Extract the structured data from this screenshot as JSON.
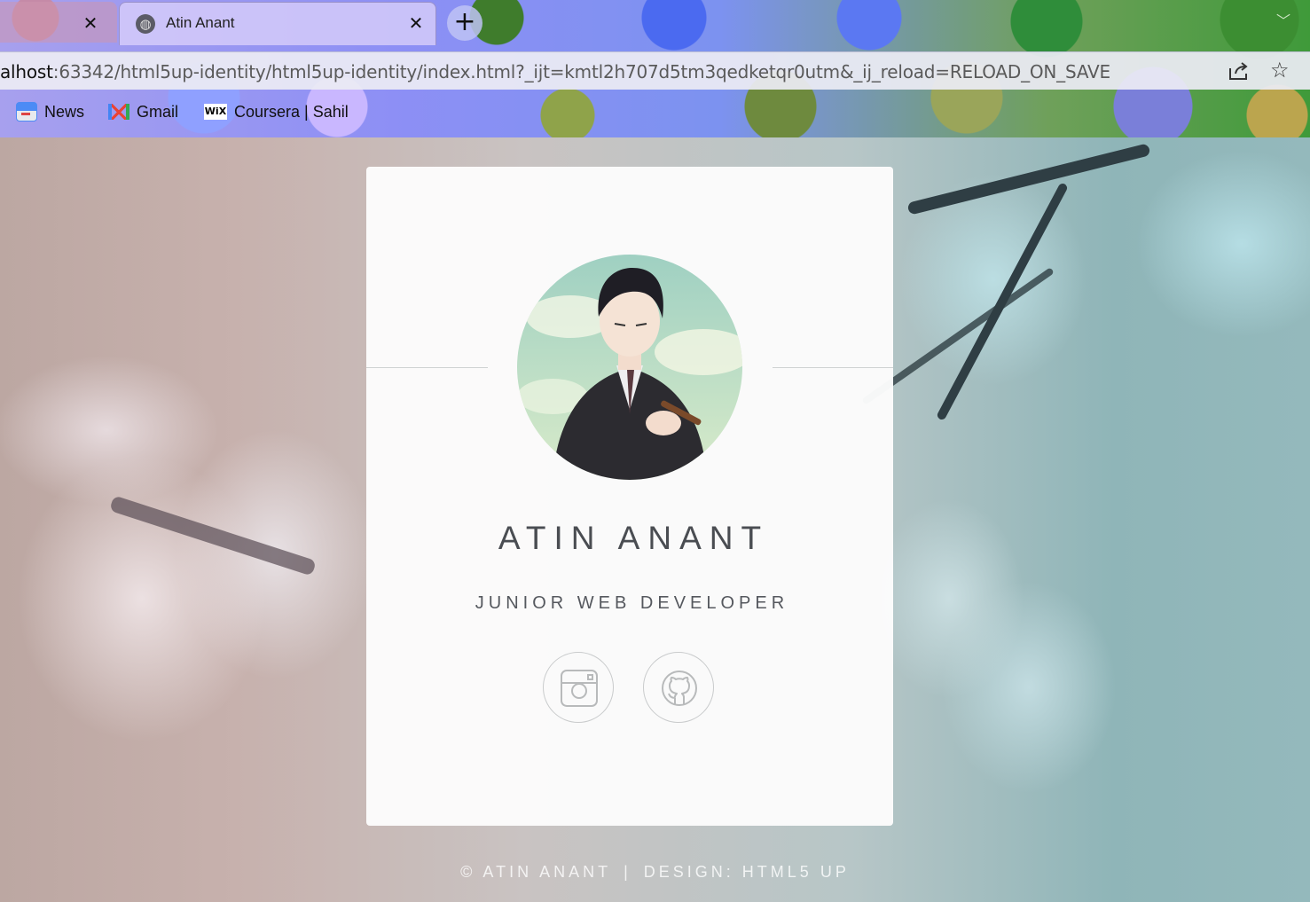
{
  "browser": {
    "tabs": [
      {
        "title": "",
        "active": false
      },
      {
        "title": "Atin Anant",
        "active": true
      }
    ],
    "new_tab_glyph": "+",
    "close_glyph": "✕",
    "url_host": "alhost",
    "url_rest": ":63342/html5up-identity/html5up-identity/index.html?_ijt=kmtl2h707d5tm3qedketqr0utm&_ij_reload=RELOAD_ON_SAVE",
    "bookmarks": [
      {
        "label": "News",
        "icon": "google-news-icon"
      },
      {
        "label": "Gmail",
        "icon": "gmail-icon"
      },
      {
        "label": "Coursera | Sahil",
        "icon": "wix-icon"
      }
    ],
    "wix_text": "WiX"
  },
  "profile": {
    "name": "ATIN ANANT",
    "role": "JUNIOR WEB DEVELOPER",
    "social": [
      {
        "icon": "instagram-icon"
      },
      {
        "icon": "github-icon"
      }
    ]
  },
  "footer": {
    "copyright": "© ATIN ANANT",
    "separator": "|",
    "design": "DESIGN: HTML5 UP"
  },
  "colors": {
    "card_bg": "#fcfcfc",
    "name_text": "#4a4d52",
    "footer_text": "#ffffff"
  }
}
